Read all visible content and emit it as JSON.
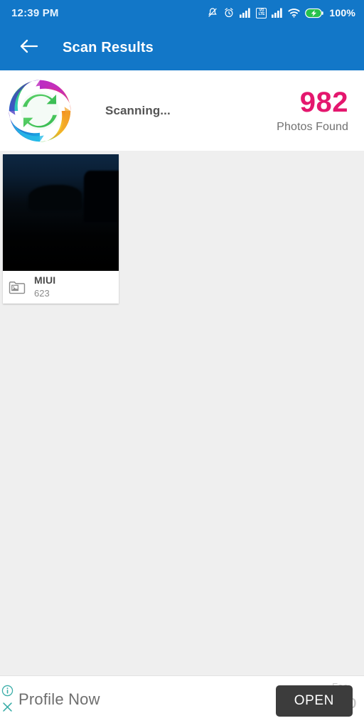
{
  "status_bar": {
    "clock": "12:39 PM",
    "battery_percent": "100%",
    "volte_top": "VO",
    "volte_bottom": "LTE",
    "icons": [
      "bell-muted-icon",
      "alarm-clock-icon",
      "signal-bars-icon",
      "volte-icon",
      "signal-bars-2-icon",
      "wifi-icon",
      "battery-charging-icon"
    ]
  },
  "app_bar": {
    "back_icon": "back-arrow-icon",
    "title": "Scan Results"
  },
  "scan_header": {
    "logo_icon": "app-logo-recycle-icon",
    "status_text": "Scanning...",
    "count": "982",
    "count_label": "Photos Found"
  },
  "content": {
    "folders": [
      {
        "name": "MIUI",
        "count": "623",
        "icon": "folder-image-icon"
      }
    ]
  },
  "ad_banner": {
    "info_icon": "ad-info-icon",
    "close_icon": "ad-close-icon",
    "headline": "Profile Now",
    "sub_small": "Fac",
    "sub_large": "Co",
    "open_label": "OPEN"
  },
  "colors": {
    "app_bar_blue": "#1277c8",
    "count_pink": "#e4176e",
    "content_gray": "#efefef",
    "ad_button_dark": "#3c3c3c",
    "ad_accent_teal": "#3aada8"
  }
}
